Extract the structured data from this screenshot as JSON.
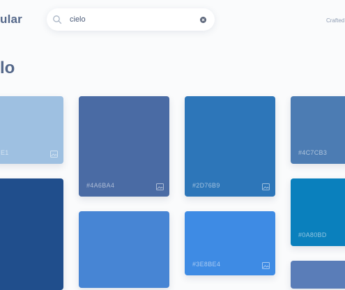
{
  "header": {
    "brand_partial": "ular",
    "crafted_partial": "Crafted"
  },
  "search": {
    "value": "cielo",
    "placeholder": ""
  },
  "page": {
    "title_partial": "lo"
  },
  "colors": [
    {
      "hex": "#9EC0E1",
      "label": "E1"
    },
    {
      "hex": "#4A6BA4",
      "label": "#4A6BA4"
    },
    {
      "hex": "#2D76B9",
      "label": "#2D76B9"
    },
    {
      "hex": "#4C7CB3",
      "label": "#4C7CB3"
    },
    {
      "hex": "#204E8C",
      "label": ""
    },
    {
      "hex": "#0A80BD",
      "label": "#0A80BD"
    },
    {
      "hex": "#4785D4",
      "label": ""
    },
    {
      "hex": "#3E8BE4",
      "label": "#3E8BE4"
    },
    {
      "hex": "#5A7DB8",
      "label": ""
    }
  ]
}
